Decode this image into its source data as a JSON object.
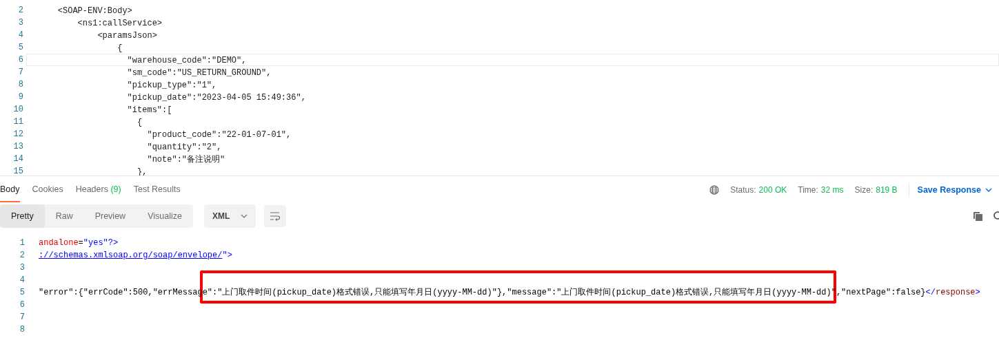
{
  "request_editor": {
    "lines": [
      {
        "number": "2",
        "text": "    <SOAP-ENV:Body>",
        "current": false
      },
      {
        "number": "3",
        "text": "        <ns1:callService>",
        "current": false
      },
      {
        "number": "4",
        "text": "            <paramsJson>",
        "current": false
      },
      {
        "number": "5",
        "text": "                {",
        "current": false
      },
      {
        "number": "6",
        "text": "                  \"warehouse_code\":\"DEMO\",",
        "current": true
      },
      {
        "number": "7",
        "text": "                  \"sm_code\":\"US_RETURN_GROUND\",",
        "current": false
      },
      {
        "number": "8",
        "text": "                  \"pickup_type\":\"1\",",
        "current": false
      },
      {
        "number": "9",
        "text": "                  \"pickup_date\":\"2023-04-05 15:49:36\",",
        "current": false
      },
      {
        "number": "10",
        "text": "                  \"items\":[",
        "current": false
      },
      {
        "number": "11",
        "text": "                    {",
        "current": false
      },
      {
        "number": "12",
        "text": "                      \"product_code\":\"22-01-07-01\",",
        "current": false
      },
      {
        "number": "13",
        "text": "                      \"quantity\":\"2\",",
        "current": false
      },
      {
        "number": "14",
        "text": "                      \"note\":\"备注说明\"",
        "current": false
      },
      {
        "number": "15",
        "text": "                    },",
        "current": false
      }
    ]
  },
  "response_tabs": [
    {
      "label": "Body",
      "selected": true
    },
    {
      "label": "Cookies",
      "selected": false
    },
    {
      "label": "Headers",
      "count": "(9)",
      "selected": false
    },
    {
      "label": "Test Results",
      "selected": false
    }
  ],
  "response_meta": {
    "status_label": "Status:",
    "status": "200 OK",
    "time_label": "Time:",
    "time": "32 ms",
    "size_label": "Size:",
    "size": "819 B",
    "save_button": "Save Response"
  },
  "view_modes": [
    {
      "label": "Pretty",
      "selected": true
    },
    {
      "label": "Raw",
      "selected": false
    },
    {
      "label": "Preview",
      "selected": false
    },
    {
      "label": "Visualize",
      "selected": false
    }
  ],
  "format_dropdown": {
    "value": "XML"
  },
  "response_body": {
    "lines": [
      {
        "number": "1",
        "segments": [
          {
            "kind": "attr",
            "text": "andalone"
          },
          {
            "kind": "plain",
            "text": "="
          },
          {
            "kind": "value",
            "text": "\"yes\"?>"
          }
        ]
      },
      {
        "number": "2",
        "segments": [
          {
            "kind": "link",
            "text": "://schemas.xmlsoap.org/soap/envelope/"
          },
          {
            "kind": "value",
            "text": "\">"
          }
        ]
      },
      {
        "number": "3"
      },
      {
        "number": "4"
      },
      {
        "number": "5",
        "segments": [
          {
            "kind": "plain",
            "text": "\"error\":{\"errCode\":500,\"errMessage\":\"上门取件时间(pickup_date)格式错误,只能填写年月日(yyyy-MM-dd)\"},\"message\":\"上门取件时间(pickup_date)格式错误,只能填写年月日(yyyy-MM-dd)\",\"nextPage\":false}"
          },
          {
            "kind": "value",
            "text": "</"
          },
          {
            "kind": "tag",
            "text": "response"
          },
          {
            "kind": "value",
            "text": ">"
          }
        ]
      },
      {
        "number": "6"
      },
      {
        "number": "7"
      },
      {
        "number": "8"
      }
    ]
  }
}
